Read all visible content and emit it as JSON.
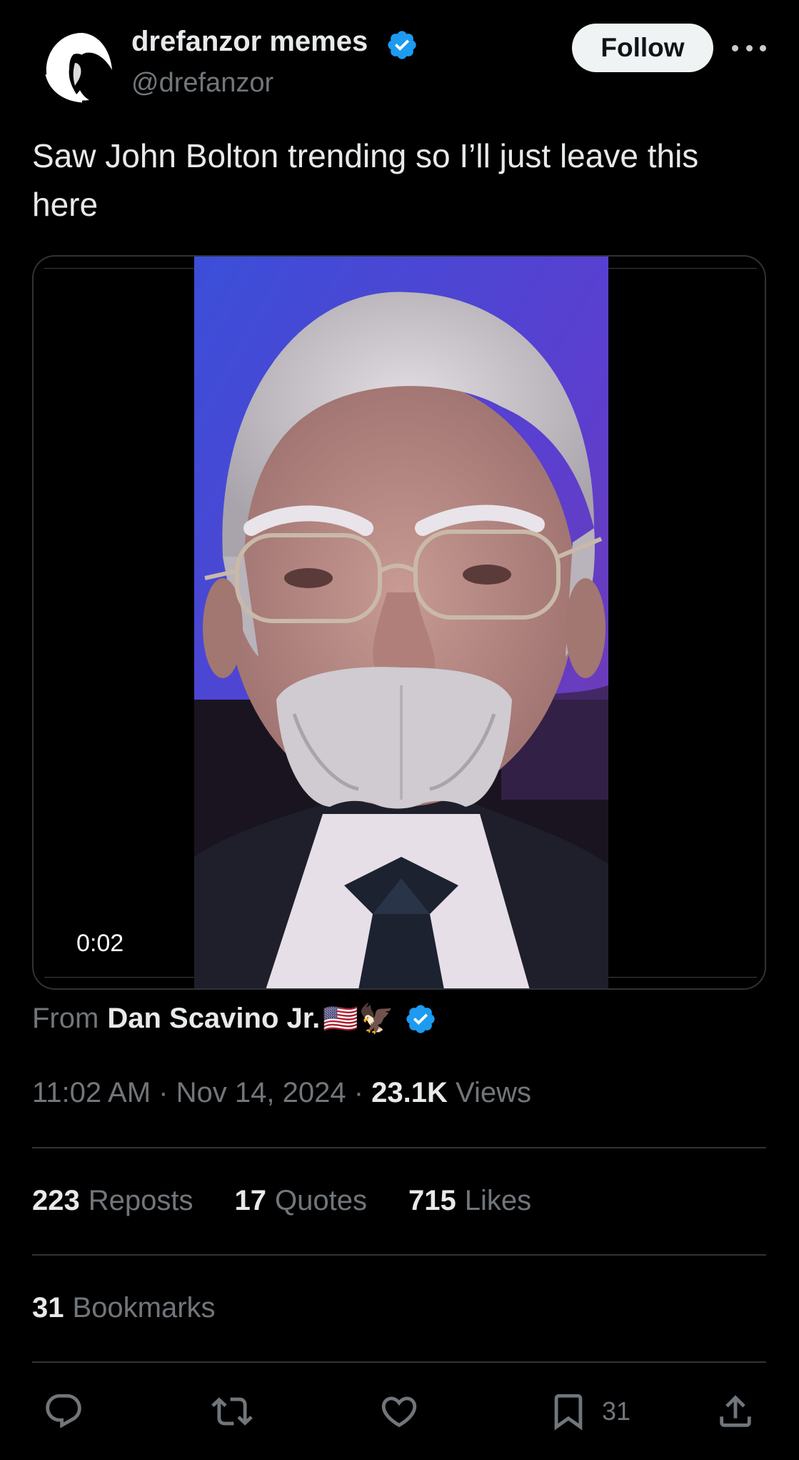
{
  "author": {
    "display_name": "drefanzor memes",
    "handle": "@drefanzor",
    "verified_color": "#1d9bf0"
  },
  "header": {
    "follow_label": "Follow"
  },
  "tweet": {
    "text": "Saw John Bolton trending so I’ll just leave this here"
  },
  "media": {
    "duration": "0:02"
  },
  "source": {
    "from_label": "From",
    "name": "Dan Scavino Jr.",
    "emojis": "🇺🇸🦅"
  },
  "meta": {
    "time": "11:02 AM",
    "date": "Nov 14, 2024",
    "views_count": "23.1K",
    "views_label": "Views",
    "separator": "·"
  },
  "stats": {
    "reposts_count": "223",
    "reposts_label": "Reposts",
    "quotes_count": "17",
    "quotes_label": "Quotes",
    "likes_count": "715",
    "likes_label": "Likes",
    "bookmarks_count": "31",
    "bookmarks_label": "Bookmarks"
  },
  "actions": {
    "bookmark_count": "31",
    "icons": [
      "reply-icon",
      "repost-icon",
      "like-icon",
      "bookmark-icon",
      "share-icon"
    ]
  }
}
